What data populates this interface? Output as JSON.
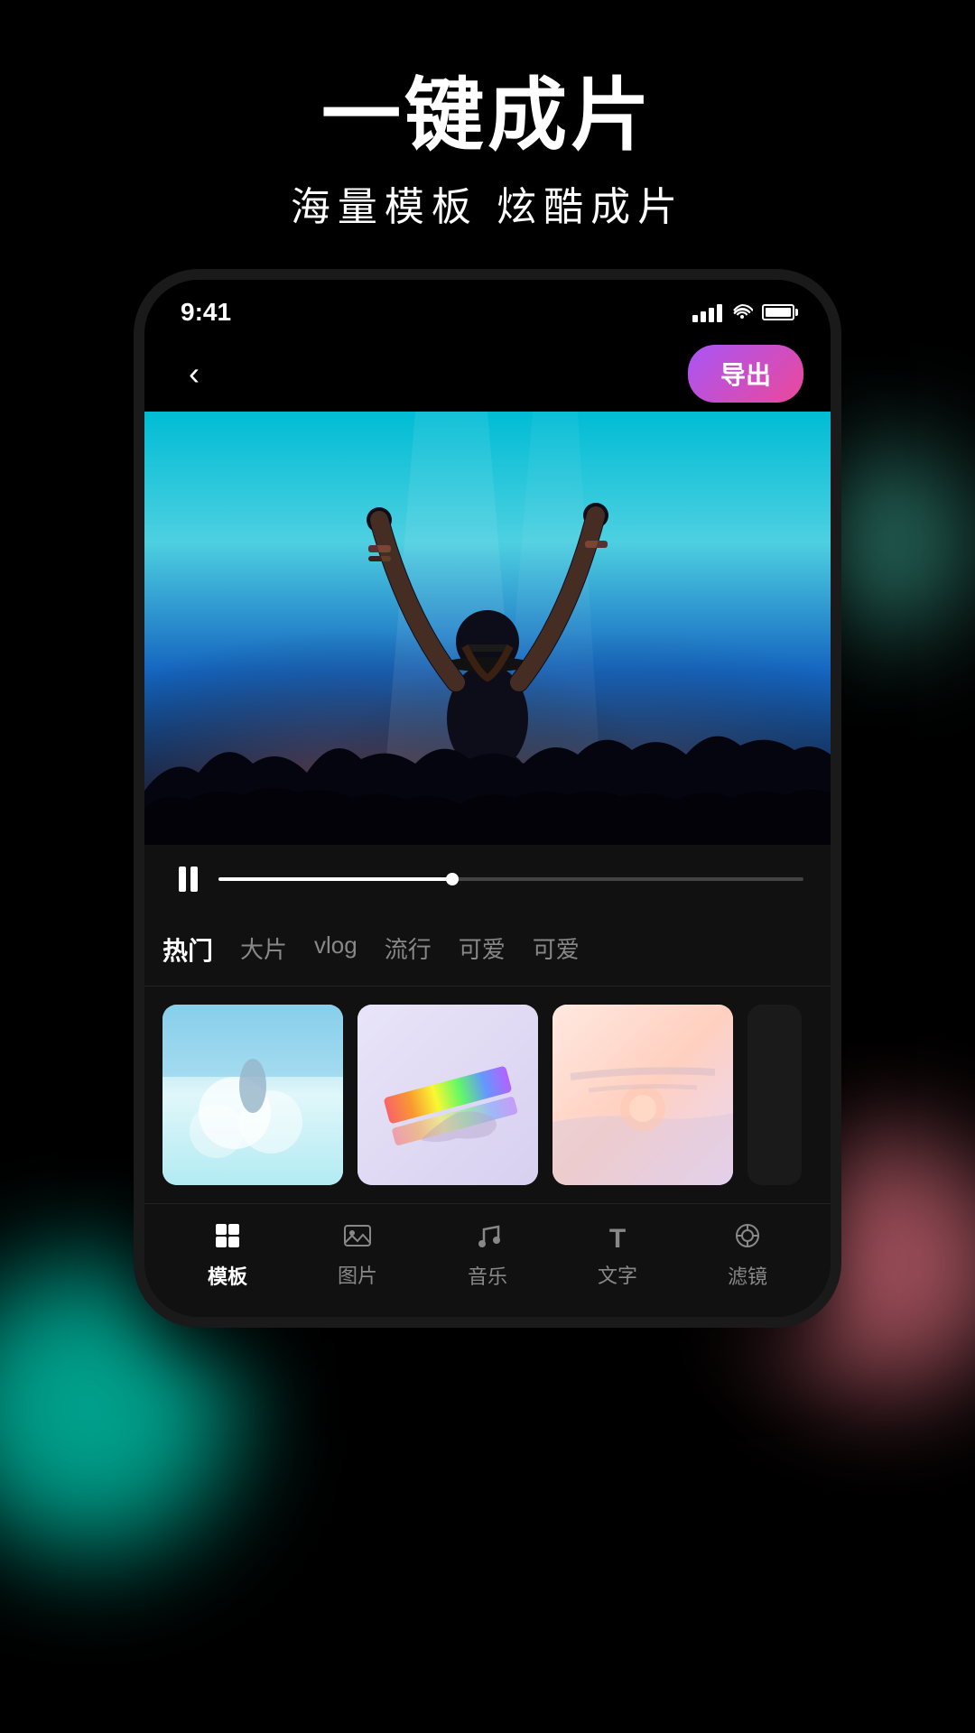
{
  "background": {
    "color": "#000000"
  },
  "hero": {
    "main_title": "一键成片",
    "sub_title": "海量模板  炫酷成片"
  },
  "status_bar": {
    "time": "9:41",
    "signal": "signal",
    "wifi": "wifi",
    "battery": "battery"
  },
  "nav": {
    "back_label": "‹",
    "export_label": "导出"
  },
  "playback": {
    "play_state": "pause"
  },
  "category_tabs": [
    {
      "id": "hot",
      "label": "热门",
      "active": true
    },
    {
      "id": "movie",
      "label": "大片",
      "active": false
    },
    {
      "id": "vlog",
      "label": "vlog",
      "active": false
    },
    {
      "id": "trend",
      "label": "流行",
      "active": false
    },
    {
      "id": "cute1",
      "label": "可爱",
      "active": false
    },
    {
      "id": "cute2",
      "label": "可爱",
      "active": false
    }
  ],
  "templates": [
    {
      "id": 1,
      "type": "sky"
    },
    {
      "id": 2,
      "type": "rainbow"
    },
    {
      "id": 3,
      "type": "sunset"
    },
    {
      "id": 4,
      "type": "partial"
    }
  ],
  "bottom_toolbar": [
    {
      "id": "template",
      "label": "模板",
      "icon": "⊞",
      "active": true
    },
    {
      "id": "image",
      "label": "图片",
      "icon": "🖼",
      "active": false
    },
    {
      "id": "music",
      "label": "音乐",
      "icon": "♪",
      "active": false
    },
    {
      "id": "text",
      "label": "文字",
      "icon": "T",
      "active": false
    },
    {
      "id": "filter",
      "label": "滤镜",
      "icon": "◈",
      "active": false
    }
  ]
}
